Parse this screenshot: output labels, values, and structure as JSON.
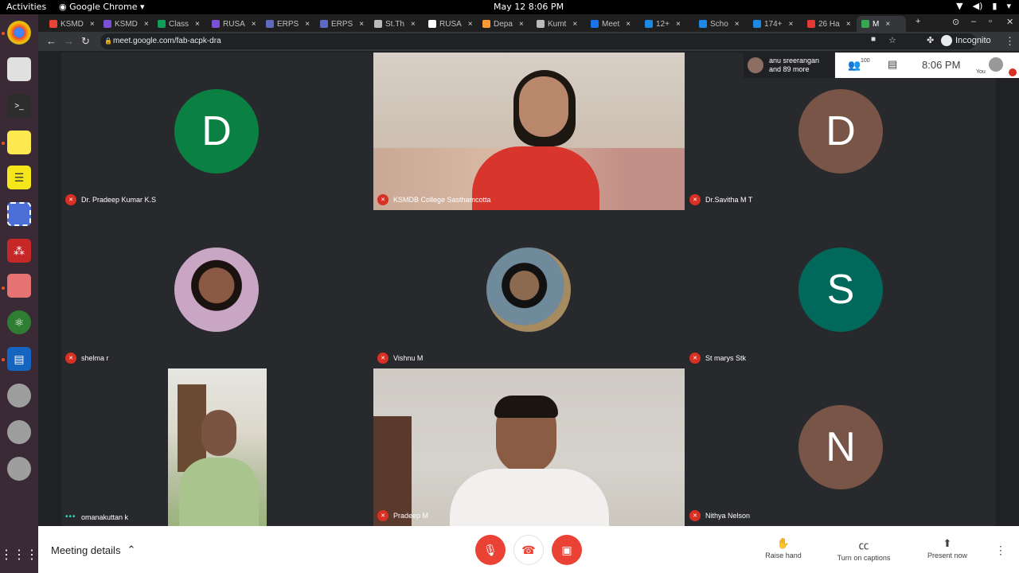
{
  "system": {
    "activities": "Activities",
    "app_name": "Google Chrome",
    "clock": "May 12  8:06 PM"
  },
  "browser": {
    "tabs": [
      {
        "label": "KSMD",
        "color": "#ea4335"
      },
      {
        "label": "KSMD",
        "color": "#7b4fd6"
      },
      {
        "label": "Class",
        "color": "#0f9d58"
      },
      {
        "label": "RUSA",
        "color": "#7b4fd6"
      },
      {
        "label": "ERPS",
        "color": "#5c6bc0"
      },
      {
        "label": "ERPS",
        "color": "#5c6bc0"
      },
      {
        "label": "St.Th",
        "color": "#bbbbbb"
      },
      {
        "label": "RUSA",
        "color": "#ffffff"
      },
      {
        "label": "Depa",
        "color": "#ff9933"
      },
      {
        "label": "Kumt",
        "color": "#bbbbbb"
      },
      {
        "label": "Meet",
        "color": "#1a73e8"
      },
      {
        "label": "12+",
        "color": "#1e88e5"
      },
      {
        "label": "Scho",
        "color": "#1e88e5"
      },
      {
        "label": "174+",
        "color": "#1e88e5"
      },
      {
        "label": "26 Ha",
        "color": "#e53935"
      },
      {
        "label": "M",
        "color": "#34a853"
      }
    ],
    "url": "meet.google.com/fab-acpk-dra",
    "incognito_label": "Incognito"
  },
  "meeting": {
    "people_chip": {
      "line1": "anu sreerangan",
      "line2": "and 89 more"
    },
    "participant_count": "100",
    "time": "8:06 PM",
    "you_label": "You",
    "tiles": [
      {
        "name": "Dr. Pradeep Kumar K.S",
        "kind": "letter",
        "letter": "D",
        "color": "#0b8043",
        "muted": true
      },
      {
        "name": "KSMDB College Sasthamcotta",
        "kind": "video",
        "muted": true
      },
      {
        "name": "Dr.Savitha M T",
        "kind": "letter",
        "letter": "D",
        "color": "#795548",
        "muted": true
      },
      {
        "name": "shelma r",
        "kind": "photo",
        "muted": true
      },
      {
        "name": "Vishnu M",
        "kind": "photo",
        "muted": true
      },
      {
        "name": "St marys Stk",
        "kind": "letter",
        "letter": "S",
        "color": "#00695c",
        "muted": true
      },
      {
        "name": "omanakuttan k",
        "kind": "video-narrow",
        "muted": false
      },
      {
        "name": "Pradeep M",
        "kind": "video",
        "muted": true
      },
      {
        "name": "Nithya Nelson",
        "kind": "letter",
        "letter": "N",
        "color": "#795548",
        "muted": true
      }
    ]
  },
  "bottom_bar": {
    "meeting_details": "Meeting details",
    "raise_hand": "Raise hand",
    "captions": "Turn on captions",
    "present": "Present now"
  }
}
